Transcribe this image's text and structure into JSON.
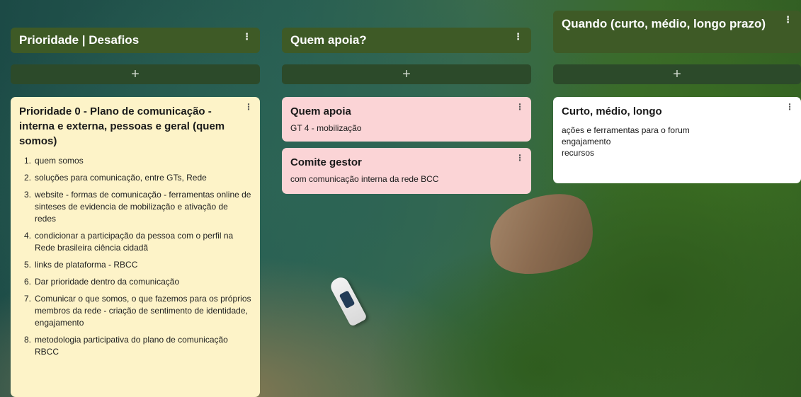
{
  "columns": [
    {
      "header": "Prioridade | Desafios",
      "add_label": "+",
      "cards": [
        {
          "title": "Prioridade 0 - Plano de comunicação - interna e externa, pessoas e geral (quem somos)",
          "items": [
            {
              "num": "1.",
              "text": "quem somos"
            },
            {
              "num": "2.",
              "text": "soluções para comunicação, entre GTs, Rede"
            },
            {
              "num": "3.",
              "text": "website - formas de comunicação - ferramentas online de sinteses de evidencia de mobilização e ativação de redes"
            },
            {
              "num": "4.",
              "text": "condicionar a participação da pessoa com o perfil na Rede brasileira ciência cidadã"
            },
            {
              "num": "5.",
              "text": "links de plataforma - RBCC"
            },
            {
              "num": "6.",
              "text": "Dar prioridade dentro da comunicação"
            },
            {
              "num": "7.",
              "text": "Comunicar o que somos,  o que fazemos para os próprios membros da rede - criação de sentimento de identidade, engajamento"
            },
            {
              "num": "8.",
              "text": "metodologia participativa do plano de comunicação RBCC"
            }
          ]
        }
      ]
    },
    {
      "header": "Quem apoia?",
      "add_label": "+",
      "cards": [
        {
          "title": "Quem apoia",
          "body": "GT 4 - mobilização"
        },
        {
          "title": "Comite gestor",
          "body": "com comunicação interna da rede BCC"
        }
      ]
    },
    {
      "header": "Quando (curto, médio, longo prazo)",
      "add_label": "+",
      "cards": [
        {
          "title": "Curto, médio, longo",
          "body_lines": [
            "ações e ferramentas para o forum",
            "engajamento",
            "recursos"
          ]
        }
      ]
    }
  ],
  "menu_icon": "vertical-dots-icon",
  "colors": {
    "header_bg": "#3e5a26",
    "add_bar_bg": "#2c4a2a",
    "card_yellow": "#fdf3c8",
    "card_pink": "#fbd4d6",
    "card_white": "#ffffff"
  }
}
